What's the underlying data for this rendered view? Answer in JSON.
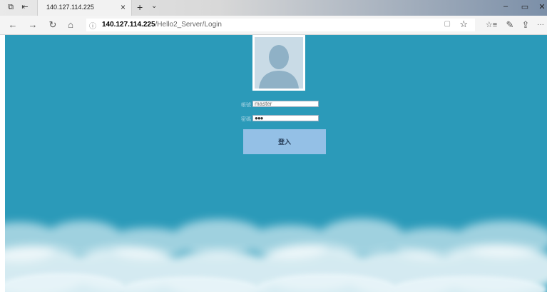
{
  "browser": {
    "tab_title": "140.127.114.225",
    "tab_close": "×",
    "new_tab": "+",
    "tab_menu": "⌄",
    "window": {
      "minimize": "–",
      "maximize": "▭",
      "close": "✕"
    },
    "url_info_icon": "ⓘ",
    "url_host": "140.127.114.225",
    "url_path": "/Hello2_Server/Login",
    "icons": {
      "back": "←",
      "forward": "→",
      "refresh": "↻",
      "home": "⌂",
      "reading_view": "▢",
      "favorite": "☆",
      "favorites_hub": "☆≡",
      "notes": "✎",
      "share": "⇪",
      "more": "···"
    }
  },
  "login": {
    "username_label": "帳號",
    "username_value": "master",
    "password_label": "密碼",
    "password_value": "●●●",
    "submit_label": "登入"
  },
  "colors": {
    "page_bg": "#2b9ab9",
    "button_bg": "#94c0e6"
  }
}
